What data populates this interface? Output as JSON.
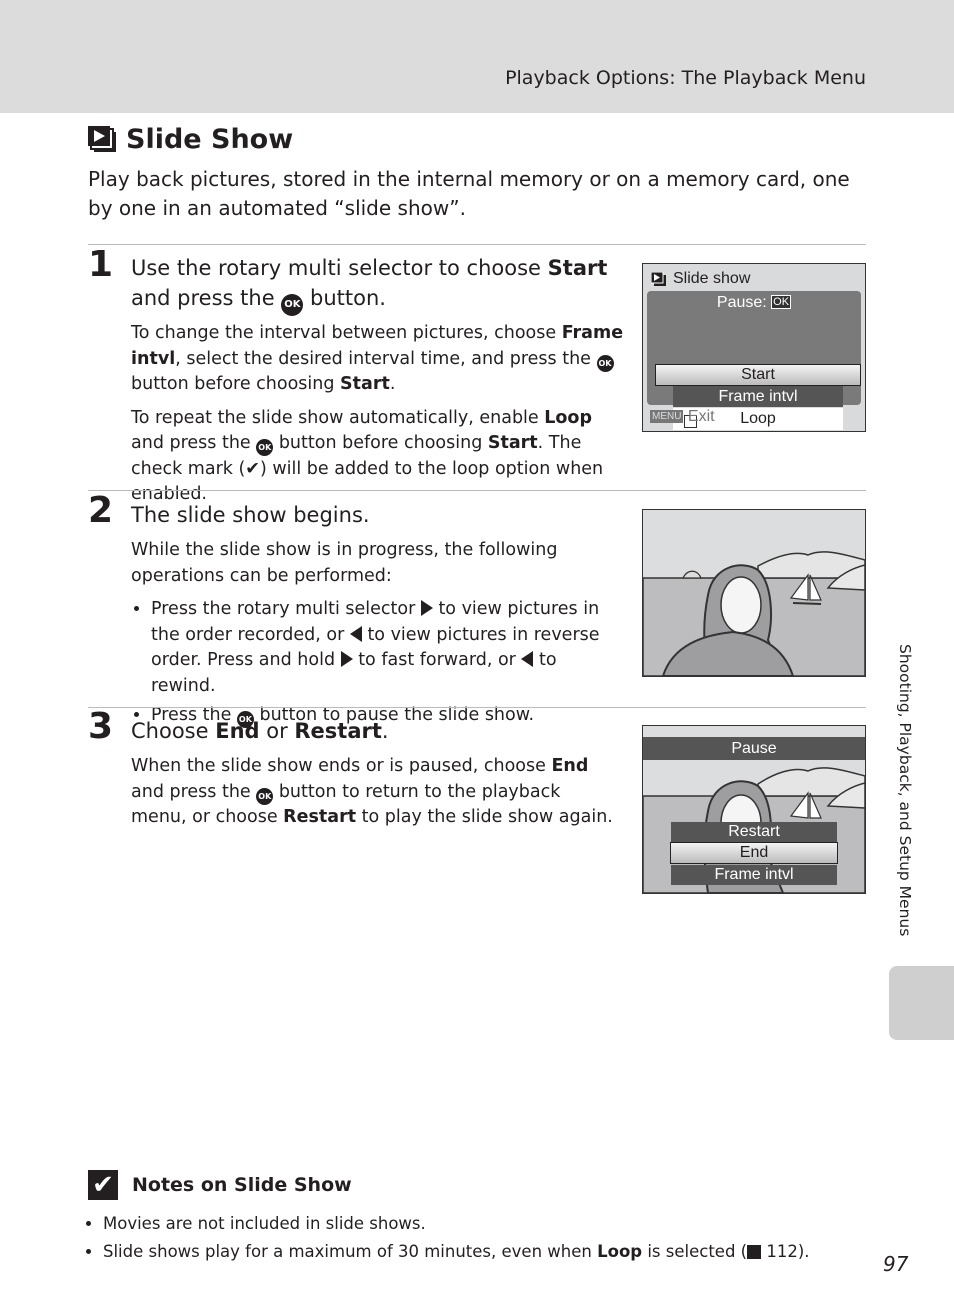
{
  "header": {
    "section": "Playback Options: The Playback Menu"
  },
  "title": {
    "icon": "slide-show-icon",
    "text": "Slide Show"
  },
  "intro": "Play back pictures, stored in the internal memory or on a memory card, one by one in an automated “slide show”.",
  "steps": [
    {
      "number": "1",
      "heading_pre": "Use the rotary multi selector to choose ",
      "heading_bold": "Start",
      "heading_mid": " and press the ",
      "heading_post": " button.",
      "p1_a": "To change the interval between pictures, choose ",
      "p1_b": "Frame intvl",
      "p1_c": ", select the desired interval time, and press the ",
      "p1_d": " button before choosing ",
      "p1_e": "Start",
      "p1_f": ".",
      "p2_a": "To repeat the slide show automatically, enable ",
      "p2_b": "Loop",
      "p2_c": " and press the ",
      "p2_d": " button before choosing ",
      "p2_e": "Start",
      "p2_f": ". The check mark (✔) will be added to the loop option when enabled."
    },
    {
      "number": "2",
      "heading": "The slide show begins.",
      "p1": "While the slide show is in progress, the following operations can be performed:",
      "b1_a": "Press the rotary multi selector ",
      "b1_b": " to view pictures in the order recorded, or ",
      "b1_c": " to view pictures in reverse order. Press and hold ",
      "b1_d": " to fast forward, or ",
      "b1_e": " to rewind.",
      "b2_a": "Press the ",
      "b2_b": " button to pause the slide show."
    },
    {
      "number": "3",
      "heading_pre": "Choose ",
      "heading_b1": "End",
      "heading_mid": " or ",
      "heading_b2": "Restart",
      "heading_post": ".",
      "p1_a": "When the slide show ends or is paused, choose ",
      "p1_b": "End",
      "p1_c": " and press the ",
      "p1_d": " button to return to the playback menu, or choose ",
      "p1_e": "Restart",
      "p1_f": " to play the slide show again."
    }
  ],
  "ok_label": "OK",
  "screen1": {
    "title": "Slide show",
    "pause": "Pause:",
    "ok": "OK",
    "items": [
      "Start",
      "Frame intvl",
      "Loop"
    ],
    "menu_badge": "MENU",
    "exit": "Exit"
  },
  "screen3": {
    "bar": "Pause",
    "items": [
      "Restart",
      "End",
      "Frame intvl"
    ]
  },
  "sidebar": {
    "text": "Shooting, Playback, and Setup Menus"
  },
  "notes": {
    "heading": "Notes on Slide Show",
    "items": {
      "n1": "Movies are not included in slide shows.",
      "n2_a": "Slide shows play for a maximum of 30 minutes, even when ",
      "n2_b": "Loop",
      "n2_c": " is selected (",
      "n2_d": " 112)."
    }
  },
  "page_number": "97"
}
